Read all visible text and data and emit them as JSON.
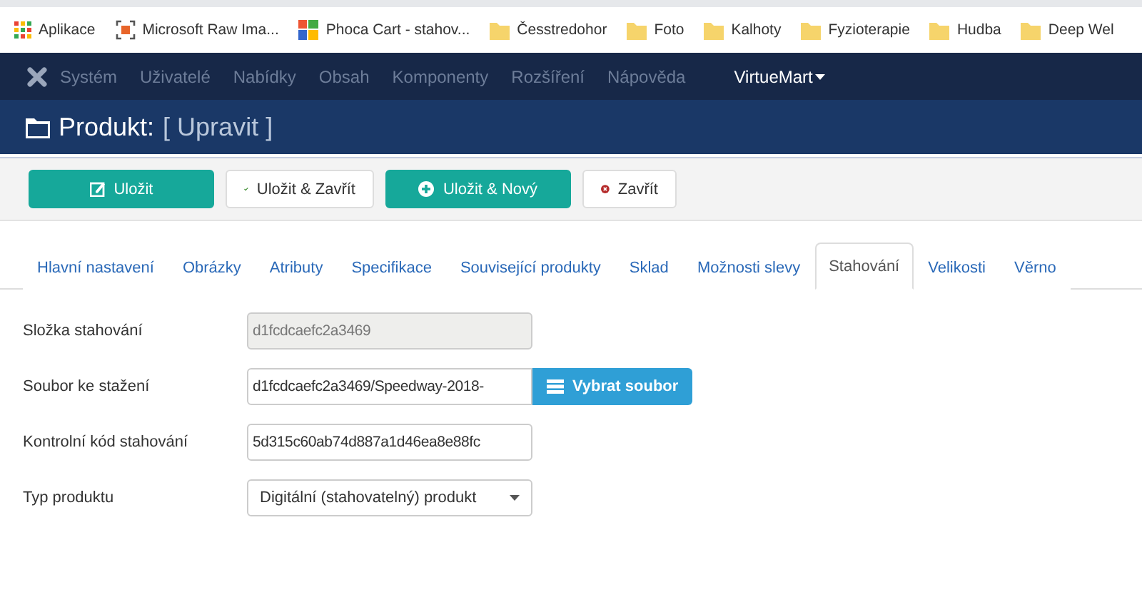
{
  "bookmarks": [
    {
      "label": "Aplikace",
      "kind": "apps"
    },
    {
      "label": "Microsoft Raw Ima...",
      "kind": "frame"
    },
    {
      "label": "Phoca Cart - stahov...",
      "kind": "tiles"
    },
    {
      "label": "Česstredohor",
      "kind": "folder"
    },
    {
      "label": "Foto",
      "kind": "folder"
    },
    {
      "label": "Kalhoty",
      "kind": "folder"
    },
    {
      "label": "Fyzioterapie",
      "kind": "folder"
    },
    {
      "label": "Hudba",
      "kind": "folder"
    },
    {
      "label": "Deep Wel",
      "kind": "folder"
    }
  ],
  "menu": [
    {
      "label": "Systém",
      "active": false
    },
    {
      "label": "Uživatelé",
      "active": false
    },
    {
      "label": "Nabídky",
      "active": false
    },
    {
      "label": "Obsah",
      "active": false
    },
    {
      "label": "Komponenty",
      "active": false
    },
    {
      "label": "Rozšíření",
      "active": false
    },
    {
      "label": "Nápověda",
      "active": false
    },
    {
      "label": "VirtueMart",
      "active": true
    }
  ],
  "header": {
    "title": "Produkt:",
    "subtitle": "[ Upravit ]"
  },
  "toolbar": [
    {
      "label": "Uložit",
      "kind": "edit",
      "primary": true
    },
    {
      "label": "Uložit & Zavřít",
      "kind": "check",
      "primary": false
    },
    {
      "label": "Uložit & Nový",
      "kind": "plus",
      "primary": true
    },
    {
      "label": "Zavřít",
      "kind": "close",
      "primary": false
    }
  ],
  "tabs": [
    {
      "label": "Hlavní nastavení",
      "selected": false
    },
    {
      "label": "Obrázky",
      "selected": false
    },
    {
      "label": "Atributy",
      "selected": false
    },
    {
      "label": "Specifikace",
      "selected": false
    },
    {
      "label": "Související produkty",
      "selected": false
    },
    {
      "label": "Sklad",
      "selected": false
    },
    {
      "label": "Možnosti slevy",
      "selected": false
    },
    {
      "label": "Stahování",
      "selected": true
    },
    {
      "label": "Velikosti",
      "selected": false
    },
    {
      "label": "Věrno",
      "selected": false
    }
  ],
  "fields": [
    {
      "label": "Složka stahování",
      "kind": "text",
      "value": "d1fcdcaefc2a3469",
      "disabled": true
    },
    {
      "label": "Soubor ke stažení",
      "kind": "file",
      "value": "d1fcdcaefc2a3469/Speedway-2018-",
      "disabled": false,
      "button": "Vybrat soubor"
    },
    {
      "label": "Kontrolní kód stahování",
      "kind": "text",
      "value": "5d315c60ab74d887a1d46ea8e88fc",
      "disabled": false
    },
    {
      "label": "Typ produktu",
      "kind": "select",
      "value": "Digitální (stahovatelný) produkt",
      "disabled": false
    }
  ]
}
